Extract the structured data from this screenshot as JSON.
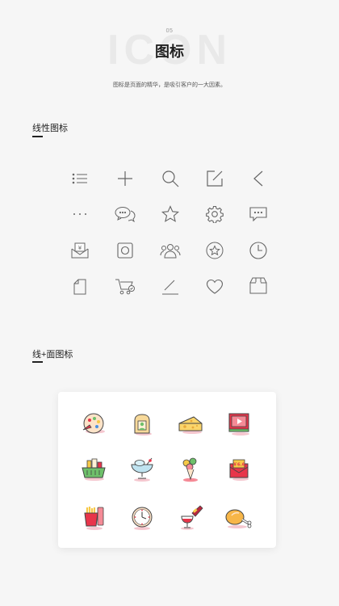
{
  "header": {
    "number": "05",
    "bg_word": "ICON",
    "title": "图标",
    "subtitle": "图标是页面的精华，是吸引客户的一大因素。"
  },
  "sections": {
    "line": {
      "title": "线性图标"
    },
    "fill": {
      "title": "线+面图标"
    }
  },
  "line_icons": [
    "list-icon",
    "plus-icon",
    "search-icon",
    "edit-icon",
    "back-arrow-icon",
    "more-icon",
    "chat-icon",
    "star-icon",
    "gear-icon",
    "message-icon",
    "yen-envelope-icon",
    "camera-icon",
    "group-icon",
    "favorite-icon",
    "clock-icon",
    "document-icon",
    "cart-icon",
    "pen-icon",
    "heart-icon",
    "box-icon"
  ],
  "fill_icons": [
    "palette-icon",
    "sandwich-icon",
    "cheese-icon",
    "video-book-icon",
    "basket-icon",
    "cocktail-icon",
    "ice-cream-icon",
    "red-envelope-icon",
    "fries-icon",
    "alarm-clock-icon",
    "wine-icon",
    "chicken-leg-icon"
  ],
  "colors": {
    "line": "#666666",
    "accent_red": "#e8354a",
    "accent_yellow": "#f7c948",
    "accent_green": "#6ec06a"
  }
}
